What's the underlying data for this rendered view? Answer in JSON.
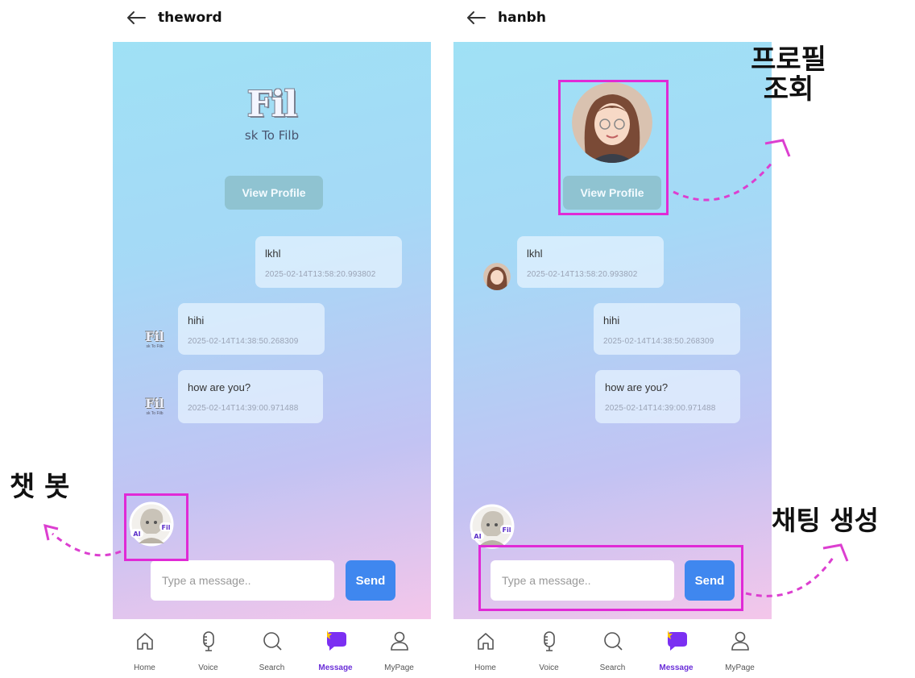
{
  "left": {
    "header_title": "theword",
    "logo_word": "Fil",
    "logo_sub": "sk To Filb",
    "view_profile_label": "View Profile",
    "messages": [
      {
        "text": "lkhl",
        "time": "2025-02-14T13:58:20.993802",
        "side": "right"
      },
      {
        "text": "hihi",
        "time": "2025-02-14T14:38:50.268309",
        "side": "left"
      },
      {
        "text": "how are you?",
        "time": "2025-02-14T14:39:00.971488",
        "side": "left"
      }
    ],
    "input_placeholder": "Type a message..",
    "send_label": "Send"
  },
  "right": {
    "header_title": "hanbh",
    "view_profile_label": "View Profile",
    "messages": [
      {
        "text": "lkhl",
        "time": "2025-02-14T13:58:20.993802",
        "side": "left"
      },
      {
        "text": "hihi",
        "time": "2025-02-14T14:38:50.268309",
        "side": "right"
      },
      {
        "text": "how are you?",
        "time": "2025-02-14T14:39:00.971488",
        "side": "right"
      }
    ],
    "input_placeholder": "Type a message..",
    "send_label": "Send"
  },
  "nav": {
    "items": [
      {
        "label": "Home",
        "icon": "home-icon"
      },
      {
        "label": "Voice",
        "icon": "microphone-icon"
      },
      {
        "label": "Search",
        "icon": "search-icon"
      },
      {
        "label": "Message",
        "icon": "chat-bubble-icon",
        "active": true
      },
      {
        "label": "MyPage",
        "icon": "user-icon"
      }
    ]
  },
  "annotations": {
    "chatbot": "챗 봇",
    "profile_line1": "프로필",
    "profile_line2": "조회",
    "chat_create": "채팅 생성"
  },
  "chatbot_badge": {
    "left": "AI",
    "right": "Fil"
  },
  "colors": {
    "highlight": "#e02ad6",
    "send_button": "#3f87ef",
    "view_profile": "#8fc3d1",
    "nav_active": "#6b2fd8"
  }
}
